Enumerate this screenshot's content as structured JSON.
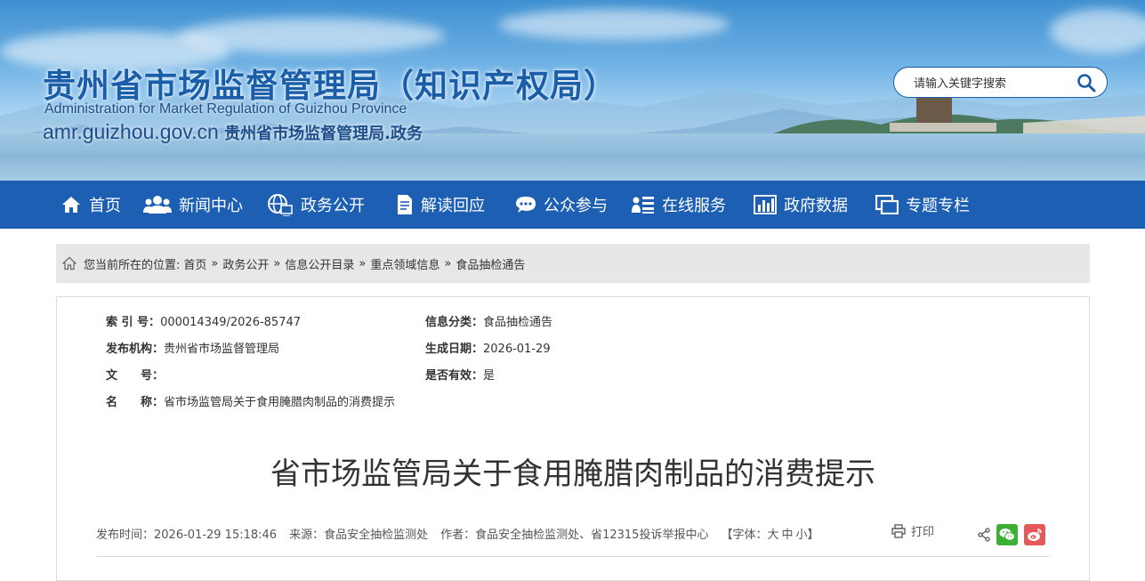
{
  "header": {
    "title_cn": "贵州省市场监督管理局（知识产权局）",
    "title_en": "Administration for Market Regulation of Guizhou Province",
    "domain": "amr.guizhou.gov.cn",
    "domain_cn": "贵州省市场监督管理局.政务"
  },
  "search": {
    "placeholder": "请输入关键字搜索",
    "icon": "search-icon"
  },
  "nav": {
    "items": [
      {
        "label": "首页",
        "icon": "home-icon"
      },
      {
        "label": "新闻中心",
        "icon": "users-icon"
      },
      {
        "label": "政务公开",
        "icon": "globe-icon"
      },
      {
        "label": "解读回应",
        "icon": "document-icon"
      },
      {
        "label": "公众参与",
        "icon": "chat-icon"
      },
      {
        "label": "在线服务",
        "icon": "user-list-icon"
      },
      {
        "label": "政府数据",
        "icon": "bar-chart-icon"
      },
      {
        "label": "专题专栏",
        "icon": "window-icon"
      }
    ],
    "color": "#1d5fb3"
  },
  "breadcrumb": {
    "prefix": "您当前所在的位置:",
    "items": [
      "首页",
      "政务公开",
      "信息公开目录",
      "重点领域信息",
      "食品抽检通告"
    ],
    "separator": "»"
  },
  "meta": {
    "index_label": "索 引 号：",
    "index_value": "000014349/2026-85747",
    "category_label": "信息分类：",
    "category_value": "食品抽检通告",
    "publisher_label": "发布机构：",
    "publisher_value": "贵州省市场监督管理局",
    "date_label": "生成日期：",
    "date_value": "2026-01-29",
    "docno_label": "文　　号：",
    "docno_value": "",
    "valid_label": "是否有效：",
    "valid_value": "是",
    "name_label": "名　　称：",
    "name_value": "省市场监管局关于食用腌腊肉制品的消费提示"
  },
  "article": {
    "title": "省市场监管局关于食用腌腊肉制品的消费提示",
    "publish_time": "发布时间：2026-01-29 15:18:46",
    "source": "来源：食品安全抽检监测处",
    "author": "作者：食品安全抽检监测处、省12315投诉举报中心",
    "font_prefix": "【字体：",
    "font_large": "大",
    "font_medium": "中",
    "font_small": "小",
    "font_suffix": "】",
    "print_label": "打印"
  }
}
